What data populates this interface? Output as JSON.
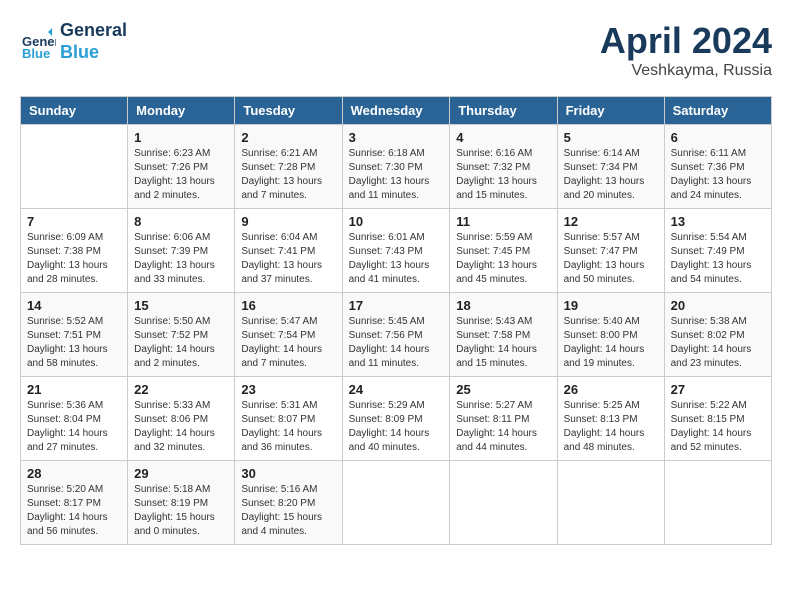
{
  "header": {
    "logo_line1": "General",
    "logo_line2": "Blue",
    "month": "April 2024",
    "location": "Veshkayma, Russia"
  },
  "weekdays": [
    "Sunday",
    "Monday",
    "Tuesday",
    "Wednesday",
    "Thursday",
    "Friday",
    "Saturday"
  ],
  "weeks": [
    [
      {
        "day": "",
        "info": ""
      },
      {
        "day": "1",
        "info": "Sunrise: 6:23 AM\nSunset: 7:26 PM\nDaylight: 13 hours\nand 2 minutes."
      },
      {
        "day": "2",
        "info": "Sunrise: 6:21 AM\nSunset: 7:28 PM\nDaylight: 13 hours\nand 7 minutes."
      },
      {
        "day": "3",
        "info": "Sunrise: 6:18 AM\nSunset: 7:30 PM\nDaylight: 13 hours\nand 11 minutes."
      },
      {
        "day": "4",
        "info": "Sunrise: 6:16 AM\nSunset: 7:32 PM\nDaylight: 13 hours\nand 15 minutes."
      },
      {
        "day": "5",
        "info": "Sunrise: 6:14 AM\nSunset: 7:34 PM\nDaylight: 13 hours\nand 20 minutes."
      },
      {
        "day": "6",
        "info": "Sunrise: 6:11 AM\nSunset: 7:36 PM\nDaylight: 13 hours\nand 24 minutes."
      }
    ],
    [
      {
        "day": "7",
        "info": "Sunrise: 6:09 AM\nSunset: 7:38 PM\nDaylight: 13 hours\nand 28 minutes."
      },
      {
        "day": "8",
        "info": "Sunrise: 6:06 AM\nSunset: 7:39 PM\nDaylight: 13 hours\nand 33 minutes."
      },
      {
        "day": "9",
        "info": "Sunrise: 6:04 AM\nSunset: 7:41 PM\nDaylight: 13 hours\nand 37 minutes."
      },
      {
        "day": "10",
        "info": "Sunrise: 6:01 AM\nSunset: 7:43 PM\nDaylight: 13 hours\nand 41 minutes."
      },
      {
        "day": "11",
        "info": "Sunrise: 5:59 AM\nSunset: 7:45 PM\nDaylight: 13 hours\nand 45 minutes."
      },
      {
        "day": "12",
        "info": "Sunrise: 5:57 AM\nSunset: 7:47 PM\nDaylight: 13 hours\nand 50 minutes."
      },
      {
        "day": "13",
        "info": "Sunrise: 5:54 AM\nSunset: 7:49 PM\nDaylight: 13 hours\nand 54 minutes."
      }
    ],
    [
      {
        "day": "14",
        "info": "Sunrise: 5:52 AM\nSunset: 7:51 PM\nDaylight: 13 hours\nand 58 minutes."
      },
      {
        "day": "15",
        "info": "Sunrise: 5:50 AM\nSunset: 7:52 PM\nDaylight: 14 hours\nand 2 minutes."
      },
      {
        "day": "16",
        "info": "Sunrise: 5:47 AM\nSunset: 7:54 PM\nDaylight: 14 hours\nand 7 minutes."
      },
      {
        "day": "17",
        "info": "Sunrise: 5:45 AM\nSunset: 7:56 PM\nDaylight: 14 hours\nand 11 minutes."
      },
      {
        "day": "18",
        "info": "Sunrise: 5:43 AM\nSunset: 7:58 PM\nDaylight: 14 hours\nand 15 minutes."
      },
      {
        "day": "19",
        "info": "Sunrise: 5:40 AM\nSunset: 8:00 PM\nDaylight: 14 hours\nand 19 minutes."
      },
      {
        "day": "20",
        "info": "Sunrise: 5:38 AM\nSunset: 8:02 PM\nDaylight: 14 hours\nand 23 minutes."
      }
    ],
    [
      {
        "day": "21",
        "info": "Sunrise: 5:36 AM\nSunset: 8:04 PM\nDaylight: 14 hours\nand 27 minutes."
      },
      {
        "day": "22",
        "info": "Sunrise: 5:33 AM\nSunset: 8:06 PM\nDaylight: 14 hours\nand 32 minutes."
      },
      {
        "day": "23",
        "info": "Sunrise: 5:31 AM\nSunset: 8:07 PM\nDaylight: 14 hours\nand 36 minutes."
      },
      {
        "day": "24",
        "info": "Sunrise: 5:29 AM\nSunset: 8:09 PM\nDaylight: 14 hours\nand 40 minutes."
      },
      {
        "day": "25",
        "info": "Sunrise: 5:27 AM\nSunset: 8:11 PM\nDaylight: 14 hours\nand 44 minutes."
      },
      {
        "day": "26",
        "info": "Sunrise: 5:25 AM\nSunset: 8:13 PM\nDaylight: 14 hours\nand 48 minutes."
      },
      {
        "day": "27",
        "info": "Sunrise: 5:22 AM\nSunset: 8:15 PM\nDaylight: 14 hours\nand 52 minutes."
      }
    ],
    [
      {
        "day": "28",
        "info": "Sunrise: 5:20 AM\nSunset: 8:17 PM\nDaylight: 14 hours\nand 56 minutes."
      },
      {
        "day": "29",
        "info": "Sunrise: 5:18 AM\nSunset: 8:19 PM\nDaylight: 15 hours\nand 0 minutes."
      },
      {
        "day": "30",
        "info": "Sunrise: 5:16 AM\nSunset: 8:20 PM\nDaylight: 15 hours\nand 4 minutes."
      },
      {
        "day": "",
        "info": ""
      },
      {
        "day": "",
        "info": ""
      },
      {
        "day": "",
        "info": ""
      },
      {
        "day": "",
        "info": ""
      }
    ]
  ]
}
